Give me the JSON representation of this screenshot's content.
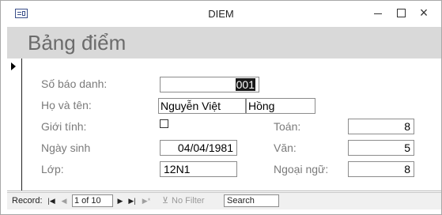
{
  "window": {
    "title": "DIEM",
    "controls": {
      "minimize": "minimize-icon",
      "maximize": "maximize-icon",
      "close": "×"
    }
  },
  "form": {
    "title": "Bảng điểm",
    "fields": {
      "so_bao_danh": {
        "label": "Số báo danh:",
        "value": "001"
      },
      "ho_va_ten": {
        "label": "Họ và tên:",
        "last_middle": "Nguyễn Việt",
        "first": "Hồng"
      },
      "gioi_tinh": {
        "label": "Giới tính:",
        "checked": false
      },
      "ngay_sinh": {
        "label": "Ngày sinh",
        "value": "04/04/1981"
      },
      "lop": {
        "label": "Lớp:",
        "value": "12N1"
      },
      "toan": {
        "label": "Toán:",
        "value": "8"
      },
      "van": {
        "label": "Văn:",
        "value": "5"
      },
      "ngoai_ngu": {
        "label": "Ngoại ngữ:",
        "value": "8"
      }
    }
  },
  "navigation": {
    "record_label": "Record:",
    "record_position": "1 of 10",
    "first": "|◀",
    "prev": "◀",
    "next": "▶",
    "last": "▶|",
    "new": "▶*",
    "filter_status": "No Filter",
    "search_label": "Search"
  }
}
